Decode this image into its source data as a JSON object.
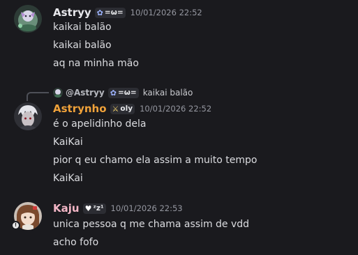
{
  "colors": {
    "background": "#1a1a1e",
    "astryy_name": "#e8e8ec",
    "astrynho_name": "#f0a23a",
    "kaju_name": "#f3b6c6",
    "message_text": "#dcdde1",
    "timestamp": "#9597a0"
  },
  "messages": [
    {
      "author": "Astryy",
      "tag": {
        "icon": "flower-icon",
        "glyph": "✿",
        "text": "=ω="
      },
      "timestamp": "10/01/2026 22:52",
      "lines": [
        "kaikai balão",
        "kaikai balão",
        "aq na minha mão"
      ]
    },
    {
      "reply": {
        "author": "@Astryy",
        "tag": {
          "icon": "flower-icon",
          "glyph": "✿",
          "text": "=ω="
        },
        "text": "kaikai balão"
      },
      "author": "Astrynho",
      "tag": {
        "icon": "sword-icon",
        "glyph": "⚔",
        "text": "oly"
      },
      "timestamp": "10/01/2026 22:52",
      "lines": [
        "é o apelidinho dela",
        "KaiKai",
        "pior q eu chamo ela assim a muito tempo",
        "KaiKai"
      ]
    },
    {
      "author": "Kaju",
      "tag": {
        "icon": "heart-icon",
        "glyph": "♥",
        "text": "ᶻz¹"
      },
      "timestamp": "10/01/2026 22:53",
      "status": "!",
      "lines": [
        "unica pessoa q me chama assim de vdd",
        "acho fofo"
      ]
    }
  ]
}
